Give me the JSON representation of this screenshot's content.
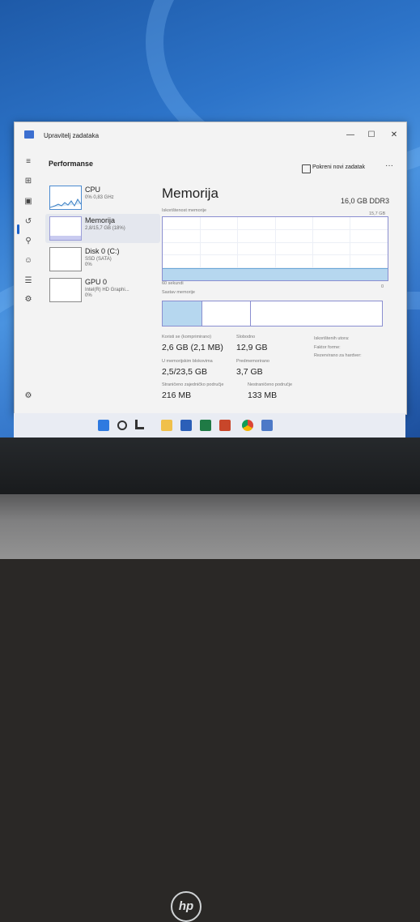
{
  "window": {
    "title": "Upravitelj zadataka",
    "minimize": "—",
    "maximize": "☐",
    "close": "✕"
  },
  "toolbar": {
    "section": "Performanse",
    "new_task": "Pokreni novi zadatak",
    "more": "···"
  },
  "nav_icons": [
    "hamburger-icon",
    "processes-icon",
    "performance-icon",
    "app-history-icon",
    "startup-apps-icon",
    "users-icon",
    "details-icon",
    "services-icon",
    "settings-icon"
  ],
  "sidebar": {
    "items": [
      {
        "name": "CPU",
        "sub": "0% 0,83 GHz",
        "sub2": ""
      },
      {
        "name": "Memorija",
        "sub": "2,8/15,7 GB (18%)",
        "sub2": ""
      },
      {
        "name": "Disk 0 (C:)",
        "sub": "SSD (SATA)",
        "sub2": "0%"
      },
      {
        "name": "GPU 0",
        "sub": "Intel(R) HD Graphi...",
        "sub2": "0%"
      }
    ]
  },
  "main": {
    "title": "Memorija",
    "type": "16,0 GB DDR3",
    "usage_label": "Iskorištenost memorije",
    "usage_max": "15,7 GB",
    "usage_fraction": 0.18,
    "time_label": "60 sekundi",
    "time_end": "0",
    "composition_label": "Sastav memorije"
  },
  "stats": {
    "in_use_label": "Koristi se (komprimirano)",
    "in_use": "2,6 GB (2,1 MB)",
    "available_label": "Slobodno",
    "available": "12,9 GB",
    "committed_label": "U memorijskim blokovima",
    "committed": "2,5/23,5 GB",
    "cached_label": "Predmemorirano",
    "cached": "3,7 GB",
    "paged_label": "Straničeno zajedničko područje",
    "paged": "216 MB",
    "nonpaged_label": "Nestraničeno područje",
    "nonpaged": "133 MB",
    "slots_label": "Iskorištenih utora:",
    "form_label": "Faktor forme:",
    "reserved_label": "Rezervirano za hardver:"
  },
  "taskbar_icons": [
    "windows-start-icon",
    "search-icon",
    "file-explorer-icon",
    "folder-icon",
    "word-icon",
    "excel-icon",
    "powerpoint-icon",
    "chrome-icon",
    "task-manager-icon"
  ],
  "laptop": {
    "logo": "hp"
  }
}
